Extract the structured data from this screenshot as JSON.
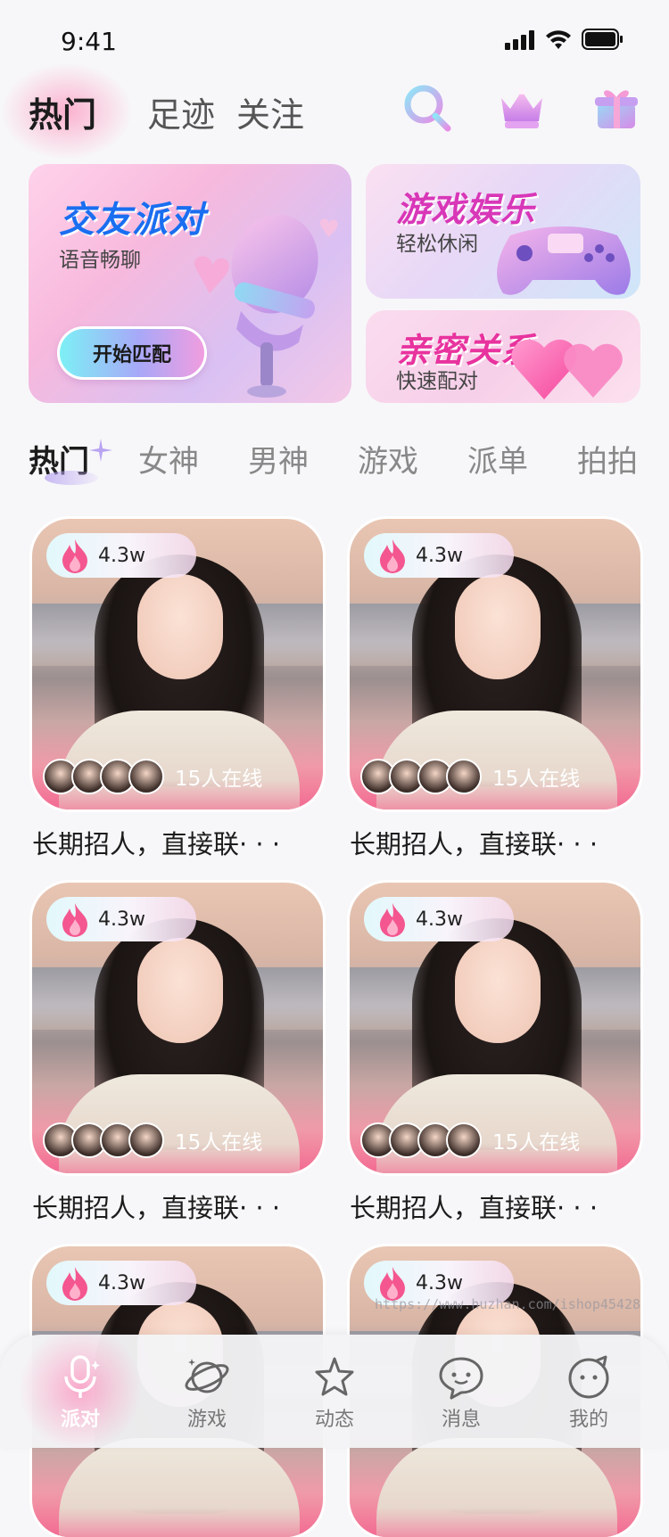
{
  "status_bar": {
    "time": "9:41"
  },
  "header": {
    "tabs": [
      {
        "label": "热门",
        "active": true
      },
      {
        "label": "足迹",
        "active": false
      },
      {
        "label": "关注",
        "active": false
      }
    ],
    "icons": [
      "search-icon",
      "crown-icon",
      "gift-icon"
    ]
  },
  "banners": {
    "party": {
      "title": "交友派对",
      "subtitle": "语音畅聊",
      "button": "开始匹配"
    },
    "game": {
      "title": "游戏娱乐",
      "subtitle": "轻松休闲"
    },
    "intimate": {
      "title": "亲密关系",
      "subtitle": "快速配对"
    }
  },
  "categories": [
    "热门",
    "女神",
    "男神",
    "游戏",
    "派单",
    "拍拍"
  ],
  "cards": [
    {
      "heat": "4.3w",
      "online": "15人在线",
      "title": "长期招人，直接联· · ·"
    },
    {
      "heat": "4.3w",
      "online": "15人在线",
      "title": "长期招人，直接联· · ·"
    },
    {
      "heat": "4.3w",
      "online": "15人在线",
      "title": "长期招人，直接联· · ·"
    },
    {
      "heat": "4.3w",
      "online": "15人在线",
      "title": "长期招人，直接联· · ·"
    },
    {
      "heat": "4.3w",
      "online": "",
      "title": ""
    },
    {
      "heat": "4.3w",
      "online": "",
      "title": ""
    }
  ],
  "bottom_nav": [
    {
      "label": "派对",
      "icon": "microphone-icon",
      "active": true
    },
    {
      "label": "游戏",
      "icon": "planet-icon",
      "active": false
    },
    {
      "label": "动态",
      "icon": "star-icon",
      "active": false
    },
    {
      "label": "消息",
      "icon": "chat-icon",
      "active": false
    },
    {
      "label": "我的",
      "icon": "profile-icon",
      "active": false
    }
  ],
  "watermark": "https://www.huzhan.com/ishop45428",
  "colors": {
    "accent_pink": "#f36a92",
    "party_blue": "#1a6ef0",
    "game_magenta": "#d837b8"
  }
}
